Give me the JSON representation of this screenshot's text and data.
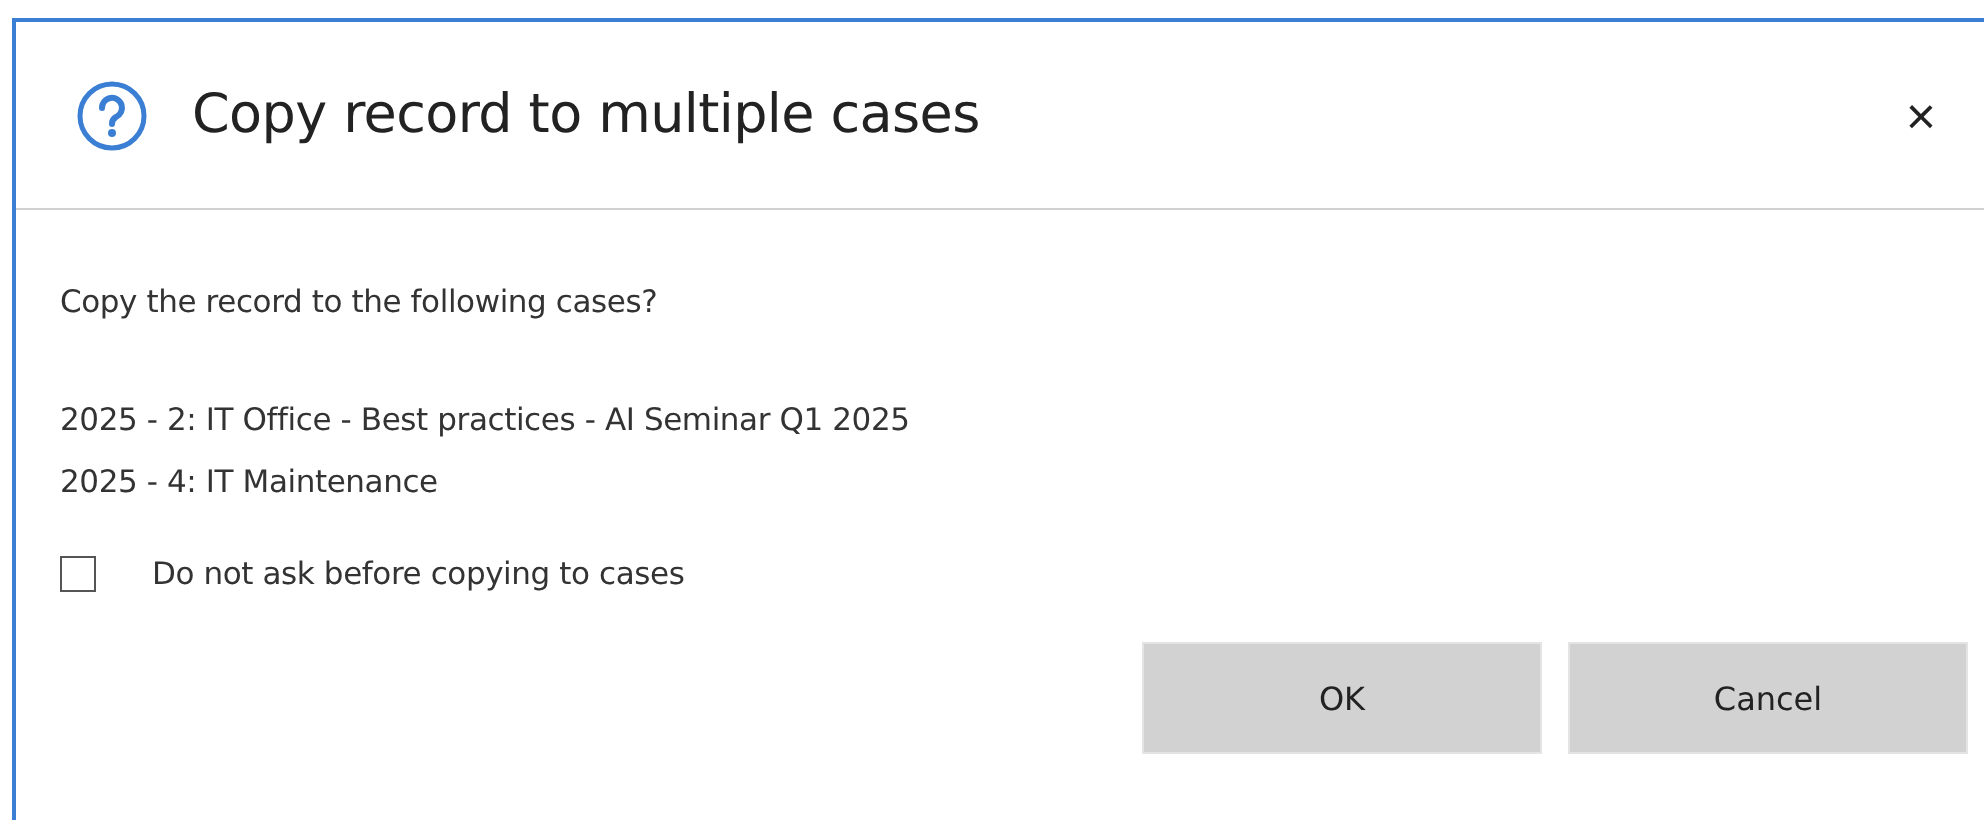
{
  "dialog": {
    "title": "Copy record to multiple cases",
    "close": "×",
    "message": "Copy the record to the following cases?",
    "cases": [
      "2025 - 2: IT Office - Best practices - AI Seminar Q1 2025",
      "2025 - 4: IT Maintenance"
    ],
    "option": {
      "label": "Do not ask before copying to cases",
      "checked": false
    },
    "buttons": [
      "OK",
      "Cancel"
    ]
  }
}
